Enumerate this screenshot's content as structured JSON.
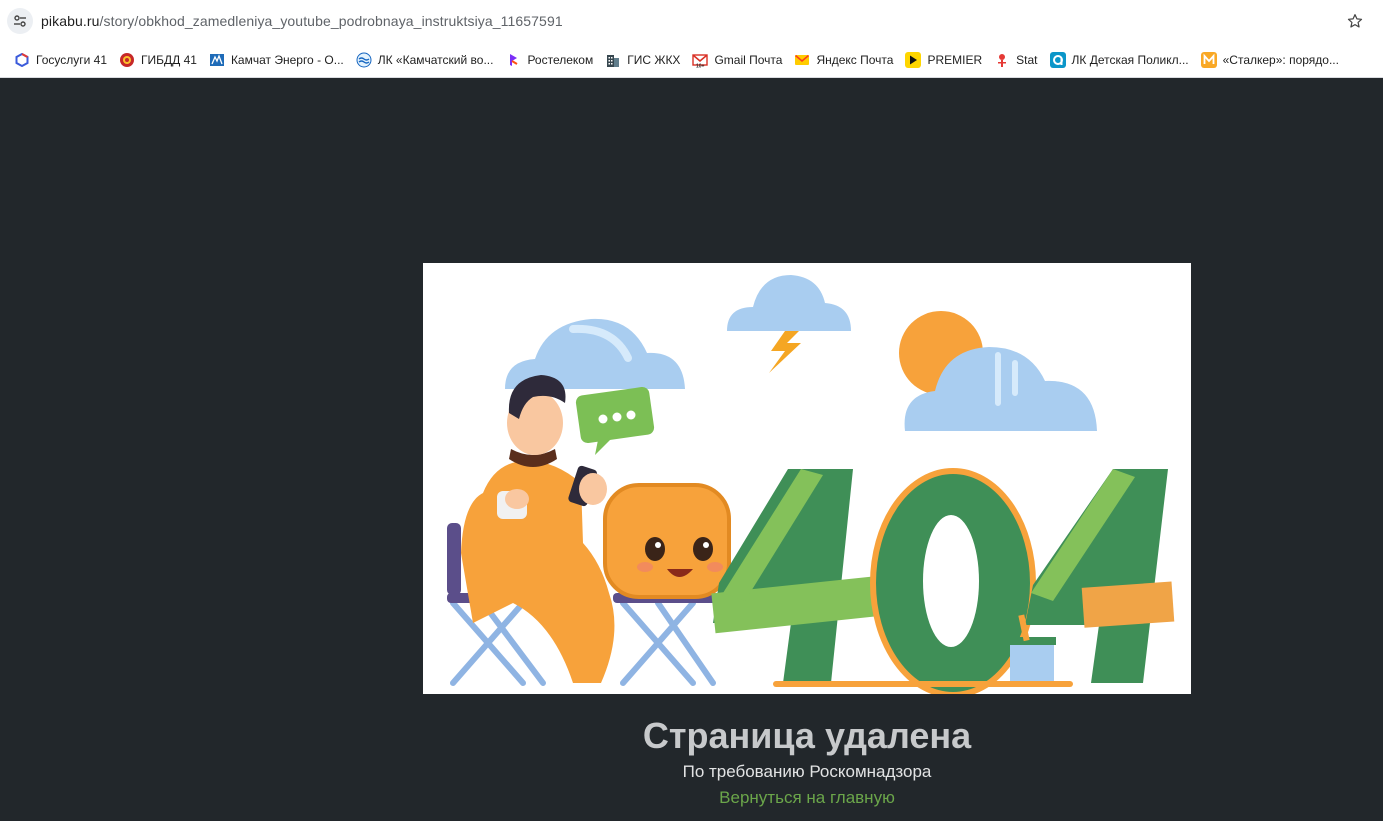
{
  "browser": {
    "url_host": "pikabu.ru",
    "url_path": "/story/obkhod_zamedleniya_youtube_podrobnaya_instruktsiya_11657591",
    "site_info_icon": "tune-icon",
    "bookmark_star_icon": "star-icon"
  },
  "bookmarks": [
    {
      "label": "Госуслуги 41",
      "icon": "gosuslugi-icon",
      "color": "#3b5bdb"
    },
    {
      "label": "ГИБДД 41",
      "icon": "gibdd-icon",
      "color": "#c62828"
    },
    {
      "label": "Камчат Энерго - О...",
      "icon": "kamchatenergo-icon",
      "color": "#1e6bb8"
    },
    {
      "label": "ЛК «Камчатский во...",
      "icon": "water-icon",
      "color": "#1565c0"
    },
    {
      "label": "Ростелеком",
      "icon": "rostelecom-icon",
      "color": "#7b2ff7"
    },
    {
      "label": "ГИС ЖКХ",
      "icon": "building-icon",
      "color": "#37474f"
    },
    {
      "label": "Gmail Почта",
      "icon": "gmail-icon",
      "color": "#d93025"
    },
    {
      "label": "Яндекс Почта",
      "icon": "mail-envelope-icon",
      "color": "#fc3f1d"
    },
    {
      "label": "PREMIER",
      "icon": "play-icon",
      "color": "#ffd600"
    },
    {
      "label": "Stat",
      "icon": "stat-icon",
      "color": "#e53935"
    },
    {
      "label": "ЛК Детская Поликл...",
      "icon": "clinic-icon",
      "color": "#0b96c9"
    },
    {
      "label": "«Сталкер»: порядо...",
      "icon": "stalker-icon",
      "color": "#f9a825"
    }
  ],
  "page": {
    "illustration": "illustration-404",
    "error_code_art": "404",
    "title": "Страница удалена",
    "subtitle": "По требованию Роскомнадзора",
    "home_link": "Вернуться на главную",
    "colors": {
      "background": "#22272b",
      "title": "#c7c9cb",
      "link": "#6ba64a"
    }
  }
}
